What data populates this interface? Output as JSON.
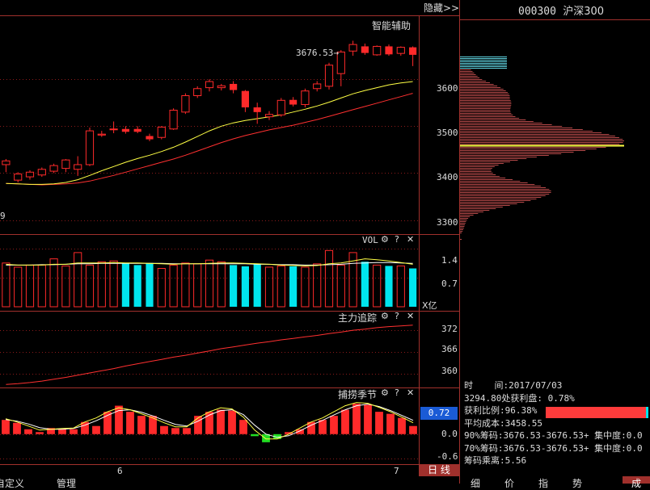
{
  "header": {
    "hide_link": "隐藏>>",
    "stock_code": "000300",
    "stock_name": "沪深300",
    "smart_assist": "智能辅助"
  },
  "colors": {
    "up": "#ff2a2a",
    "down": "#00e5ee",
    "ma_yellow": "#ffff44",
    "ma_red": "#ff3030",
    "grid": "#8b1a1a",
    "border": "#a0302c"
  },
  "price_panel": {
    "max_label": "3676.53",
    "left_label": "9",
    "y_ticks": [
      "3600",
      "3500",
      "3400",
      "3300"
    ]
  },
  "vol_panel": {
    "title": "VOL",
    "y_ticks": [
      "1.4",
      "0.7"
    ],
    "unit": "X亿"
  },
  "track_panel": {
    "title": "主力追踪",
    "y_ticks": [
      "372",
      "366",
      "360"
    ]
  },
  "season_panel": {
    "title": "捕捞季节",
    "value_badge": "0.72",
    "y_ticks": [
      "0.0",
      "-0.6"
    ]
  },
  "x_axis": {
    "labels": [
      "6",
      "7"
    ],
    "period_button": "日 线"
  },
  "bottom_tabs": [
    "自定义",
    "管理"
  ],
  "right_tabs": [
    "细",
    "价",
    "指",
    "势",
    "成"
  ],
  "chip_info": {
    "time_label": "时    间:",
    "time_value": "2017/07/03",
    "profit_line": "3294.80处获利盘: 0.78%",
    "profit_ratio_label": "获利比例:",
    "profit_ratio_value": "96.38%",
    "avg_cost": "平均成本:3458.55",
    "chip90": "90%筹码:3676.53-3676.53+ 集中度:0.0",
    "chip70": "70%筹码:3676.53-3676.53+ 集中度:0.0",
    "chip_mult": "筹码乘离:5.56"
  },
  "chart_data": {
    "type": "candlestick",
    "candles": [
      {
        "o": 3418,
        "h": 3430,
        "l": 3402,
        "c": 3426
      },
      {
        "o": 3385,
        "h": 3402,
        "l": 3380,
        "c": 3398
      },
      {
        "o": 3392,
        "h": 3406,
        "l": 3386,
        "c": 3402
      },
      {
        "o": 3396,
        "h": 3412,
        "l": 3392,
        "c": 3408
      },
      {
        "o": 3404,
        "h": 3420,
        "l": 3400,
        "c": 3416
      },
      {
        "o": 3410,
        "h": 3430,
        "l": 3402,
        "c": 3428
      },
      {
        "o": 3408,
        "h": 3436,
        "l": 3394,
        "c": 3418
      },
      {
        "o": 3418,
        "h": 3497,
        "l": 3415,
        "c": 3490
      },
      {
        "o": 3481,
        "h": 3490,
        "l": 3477,
        "c": 3483
      },
      {
        "o": 3494,
        "h": 3510,
        "l": 3485,
        "c": 3494
      },
      {
        "o": 3494,
        "h": 3500,
        "l": 3484,
        "c": 3488
      },
      {
        "o": 3494,
        "h": 3500,
        "l": 3485,
        "c": 3488
      },
      {
        "o": 3479,
        "h": 3484,
        "l": 3468,
        "c": 3472
      },
      {
        "o": 3476,
        "h": 3500,
        "l": 3472,
        "c": 3498
      },
      {
        "o": 3494,
        "h": 3538,
        "l": 3492,
        "c": 3534
      },
      {
        "o": 3530,
        "h": 3570,
        "l": 3526,
        "c": 3565
      },
      {
        "o": 3565,
        "h": 3585,
        "l": 3560,
        "c": 3580
      },
      {
        "o": 3582,
        "h": 3600,
        "l": 3574,
        "c": 3595
      },
      {
        "o": 3582,
        "h": 3590,
        "l": 3576,
        "c": 3586
      },
      {
        "o": 3590,
        "h": 3596,
        "l": 3570,
        "c": 3577
      },
      {
        "o": 3575,
        "h": 3577,
        "l": 3530,
        "c": 3540
      },
      {
        "o": 3540,
        "h": 3550,
        "l": 3505,
        "c": 3530
      },
      {
        "o": 3520,
        "h": 3532,
        "l": 3513,
        "c": 3525
      },
      {
        "o": 3524,
        "h": 3560,
        "l": 3520,
        "c": 3555
      },
      {
        "o": 3556,
        "h": 3562,
        "l": 3542,
        "c": 3546
      },
      {
        "o": 3546,
        "h": 3580,
        "l": 3540,
        "c": 3575
      },
      {
        "o": 3580,
        "h": 3596,
        "l": 3574,
        "c": 3590
      },
      {
        "o": 3585,
        "h": 3635,
        "l": 3578,
        "c": 3630
      },
      {
        "o": 3612,
        "h": 3662,
        "l": 3585,
        "c": 3658
      },
      {
        "o": 3660,
        "h": 3682,
        "l": 3650,
        "c": 3674
      },
      {
        "o": 3670,
        "h": 3676,
        "l": 3652,
        "c": 3656
      },
      {
        "o": 3652,
        "h": 3672,
        "l": 3650,
        "c": 3670
      },
      {
        "o": 3670,
        "h": 3674,
        "l": 3650,
        "c": 3653
      },
      {
        "o": 3655,
        "h": 3670,
        "l": 3650,
        "c": 3668
      },
      {
        "o": 3668,
        "h": 3670,
        "l": 3628,
        "c": 3652
      }
    ],
    "ma_short": [
      3378,
      3377,
      3376,
      3376,
      3377,
      3380,
      3386,
      3395,
      3405,
      3414,
      3423,
      3431,
      3438,
      3446,
      3455,
      3466,
      3478,
      3490,
      3500,
      3507,
      3512,
      3516,
      3520,
      3524,
      3530,
      3536,
      3543,
      3551,
      3560,
      3569,
      3576,
      3582,
      3588,
      3592,
      3595
    ],
    "ma_long": [
      3378,
      3377,
      3376,
      3375,
      3376,
      3377,
      3379,
      3383,
      3389,
      3395,
      3402,
      3409,
      3416,
      3423,
      3430,
      3438,
      3447,
      3456,
      3465,
      3473,
      3480,
      3486,
      3492,
      3497,
      3502,
      3508,
      3514,
      3521,
      3528,
      3535,
      3542,
      3549,
      3556,
      3563,
      3570
    ],
    "ylim": [
      3270,
      3700
    ],
    "volume": {
      "values": [
        1.05,
        0.95,
        1.0,
        1.0,
        1.15,
        0.98,
        1.3,
        1.0,
        1.08,
        1.1,
        1.05,
        1.0,
        1.05,
        0.92,
        1.0,
        1.05,
        1.03,
        1.12,
        1.08,
        1.0,
        0.97,
        1.02,
        0.95,
        0.98,
        0.97,
        0.95,
        1.03,
        1.35,
        1.0,
        1.3,
        1.08,
        1.0,
        0.98,
        0.98,
        0.92
      ],
      "ma1": [
        1.02,
        1.0,
        1.0,
        1.0,
        1.02,
        1.02,
        1.05,
        1.05,
        1.05,
        1.06,
        1.05,
        1.05,
        1.04,
        1.03,
        1.02,
        1.03,
        1.03,
        1.04,
        1.05,
        1.05,
        1.04,
        1.03,
        1.02,
        1.0,
        0.99,
        0.98,
        0.99,
        1.03,
        1.05,
        1.1,
        1.15,
        1.13,
        1.1,
        1.06,
        1.02
      ],
      "ma2": [
        1.0,
        1.0,
        1.0,
        1.01,
        1.01,
        1.02,
        1.03,
        1.03,
        1.04,
        1.04,
        1.04,
        1.04,
        1.04,
        1.04,
        1.03,
        1.03,
        1.03,
        1.03,
        1.03,
        1.03,
        1.03,
        1.02,
        1.02,
        1.01,
        1.01,
        1.0,
        1.0,
        1.01,
        1.02,
        1.04,
        1.05,
        1.06,
        1.06,
        1.05,
        1.04
      ],
      "ylim": [
        0,
        1.55
      ]
    },
    "track": {
      "values": [
        357.2,
        357.4,
        357.7,
        358.1,
        358.6,
        359.1,
        359.7,
        360.3,
        360.9,
        361.5,
        362.2,
        362.8,
        363.4,
        364.0,
        364.6,
        365.1,
        365.7,
        366.3,
        366.9,
        367.4,
        367.9,
        368.4,
        368.8,
        369.3,
        369.7,
        370.1,
        370.5,
        371.0,
        371.4,
        371.9,
        372.2,
        372.6,
        372.9,
        373.1,
        373.3
      ],
      "ylim": [
        356.8,
        375
      ]
    },
    "season": {
      "values": [
        0.35,
        0.28,
        0.12,
        0.05,
        0.15,
        0.12,
        0.12,
        0.3,
        0.2,
        0.55,
        0.7,
        0.55,
        0.45,
        0.45,
        0.2,
        0.15,
        0.15,
        0.45,
        0.55,
        0.6,
        0.58,
        0.35,
        -0.05,
        -0.2,
        -0.12,
        0.05,
        0.12,
        0.3,
        0.35,
        0.45,
        0.6,
        0.75,
        0.72,
        0.55,
        0.5,
        0.4,
        0.2
      ],
      "line1": [
        0.38,
        0.3,
        0.2,
        0.1,
        0.12,
        0.14,
        0.15,
        0.3,
        0.4,
        0.55,
        0.65,
        0.6,
        0.5,
        0.4,
        0.28,
        0.18,
        0.18,
        0.4,
        0.55,
        0.65,
        0.62,
        0.42,
        0.1,
        -0.12,
        -0.12,
        0.0,
        0.15,
        0.3,
        0.4,
        0.55,
        0.7,
        0.78,
        0.76,
        0.66,
        0.55,
        0.42,
        0.28
      ],
      "line2": [
        0.36,
        0.32,
        0.25,
        0.16,
        0.12,
        0.12,
        0.14,
        0.22,
        0.33,
        0.46,
        0.58,
        0.6,
        0.54,
        0.45,
        0.34,
        0.24,
        0.2,
        0.32,
        0.47,
        0.58,
        0.6,
        0.48,
        0.22,
        0.0,
        -0.08,
        -0.04,
        0.08,
        0.22,
        0.34,
        0.47,
        0.6,
        0.7,
        0.74,
        0.68,
        0.58,
        0.46,
        0.34
      ],
      "ylim": [
        -0.7,
        0.95
      ]
    },
    "chip_distribution": {
      "price_range": [
        3270,
        3700
      ],
      "avg_cost": 3458.55
    }
  }
}
